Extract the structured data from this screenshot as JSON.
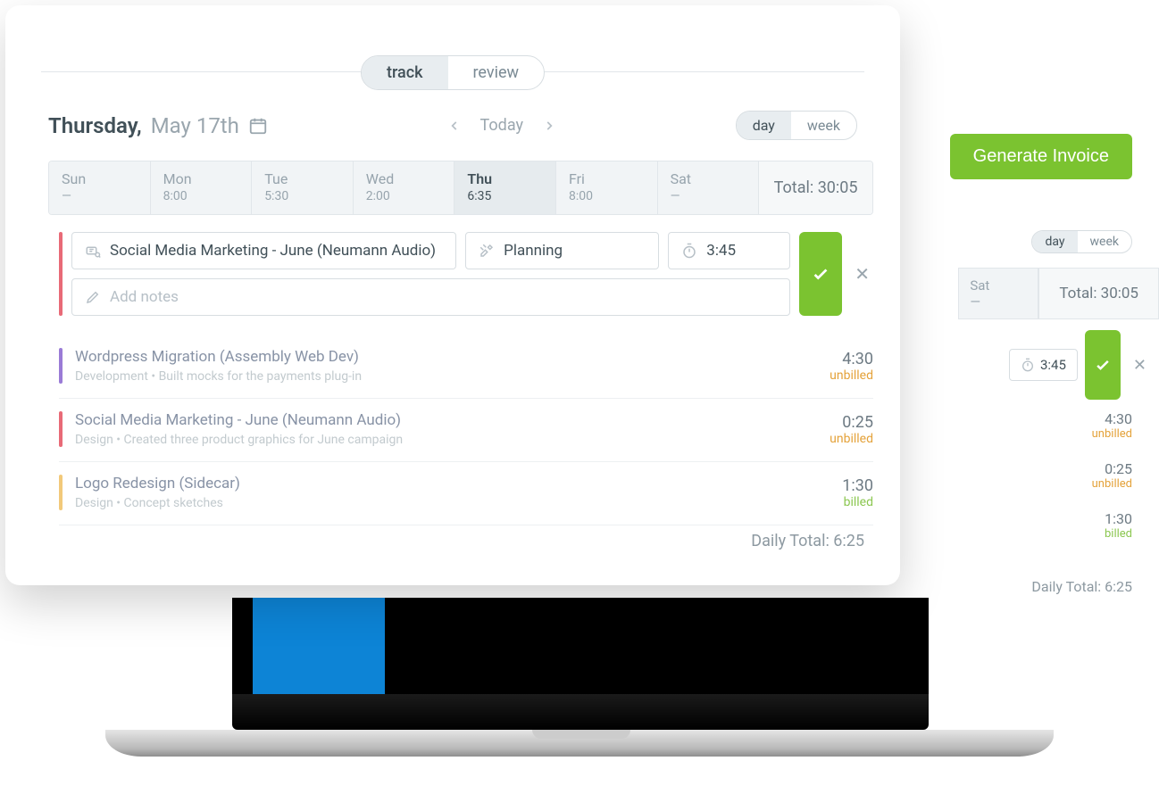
{
  "panel": {
    "tabs": {
      "track": "track",
      "review": "review",
      "active": "track"
    },
    "date": {
      "dow": "Thursday,",
      "md": "May 17th"
    },
    "nav": {
      "today": "Today"
    },
    "view_toggle": {
      "day": "day",
      "week": "week",
      "active": "day"
    },
    "week": {
      "days": [
        {
          "name": "Sun",
          "value": "—"
        },
        {
          "name": "Mon",
          "value": "8:00"
        },
        {
          "name": "Tue",
          "value": "5:30"
        },
        {
          "name": "Wed",
          "value": "2:00"
        },
        {
          "name": "Thu",
          "value": "6:35",
          "selected": true
        },
        {
          "name": "Fri",
          "value": "8:00"
        },
        {
          "name": "Sat",
          "value": "—"
        }
      ],
      "total_label": "Total: 30:05"
    },
    "editor": {
      "project": "Social Media Marketing - June (Neumann Audio)",
      "task": "Planning",
      "time": "3:45",
      "notes_placeholder": "Add notes"
    },
    "entries": [
      {
        "color": "#9a7bd6",
        "title": "Wordpress Migration (Assembly Web Dev)",
        "meta": "Development  •  Built mocks for the payments plug-in",
        "time": "4:30",
        "status": "unbilled"
      },
      {
        "color": "#e86a77",
        "title": "Social Media Marketing - June (Neumann Audio)",
        "meta": "Design  •  Created three product graphics for June campaign",
        "time": "0:25",
        "status": "unbilled"
      },
      {
        "color": "#f2c97a",
        "title": "Logo Redesign (Sidecar)",
        "meta": "Design  •  Concept sketches",
        "time": "1:30",
        "status": "billed"
      }
    ],
    "daily_total": "Daily Total: 6:25"
  },
  "background": {
    "generate_invoice": "Generate Invoice",
    "view_toggle": {
      "day": "day",
      "week": "week",
      "active": "day"
    },
    "days_tail": [
      {
        "name": "Sat",
        "value": "—"
      }
    ],
    "total_label": "Total: 30:05",
    "editor_time": "3:45",
    "entries": [
      {
        "time": "4:30",
        "status": "unbilled"
      },
      {
        "time": "0:25",
        "status": "unbilled"
      },
      {
        "time": "1:30",
        "status": "billed"
      }
    ],
    "daily_total": "Daily Total: 6:25"
  }
}
